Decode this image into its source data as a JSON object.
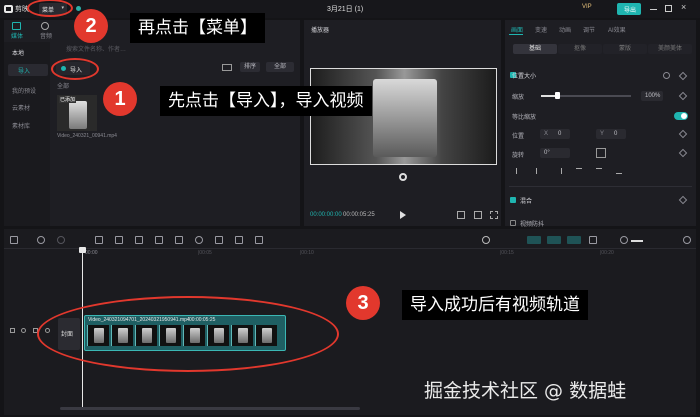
{
  "titlebar": {
    "app_name": "剪映",
    "menu_label": "菜单",
    "project_date": "3月21日 (1)",
    "vip_label": "VIP",
    "export_label": "导出"
  },
  "media_panel": {
    "tabs": [
      "媒体",
      "音频"
    ],
    "side_items": [
      "本地",
      "导入",
      "我的预设",
      "云素材",
      "素材库"
    ],
    "import_button": "导入",
    "search_hint": "搜索文件名称、作者…",
    "view_controls": [
      "排序",
      "全部"
    ],
    "section_label": "全部",
    "clip_badge": "已添加",
    "clip_name": "Video_240321_00941.mp4"
  },
  "player": {
    "title": "播放器",
    "time_current": "00:00:00:00",
    "time_total": "00:00:05:25"
  },
  "properties": {
    "tabs": [
      "画面",
      "变速",
      "动画",
      "调节",
      "AI效果"
    ],
    "subtabs": [
      "基础",
      "抠像",
      "蒙版",
      "美颜美体"
    ],
    "section_title": "位置大小",
    "scale_label": "缩放",
    "scale_value": "100%",
    "uniform_scale_label": "等比缩放",
    "position_label": "位置",
    "position_x_axis": "X",
    "position_x": "0",
    "position_y_axis": "Y",
    "position_y": "0",
    "rotate_label": "旋转",
    "rotate_value": "0°",
    "blend_label": "混合",
    "stabilize_label": "视频防抖"
  },
  "timeline": {
    "ruler_ticks": [
      "00:00",
      "|00:05",
      "|00:10",
      "|00:15",
      "|00:20"
    ],
    "cover_label": "封面",
    "clip_title": "Video_240321094701_20240321950941.mp4",
    "clip_duration": "00:00:05:25"
  },
  "annotations": {
    "step1_number": "1",
    "step1_text": "先点击【导入】，导入视频",
    "step2_number": "2",
    "step2_text": "再点击【菜单】",
    "step3_number": "3",
    "step3_text": "导入成功后有视频轨道"
  },
  "watermark": "掘金技术社区 @ 数据蛙",
  "colors": {
    "accent_teal": "#1fb5b0",
    "annotation_red": "#e2382d",
    "clip_teal": "#1f5f63"
  }
}
